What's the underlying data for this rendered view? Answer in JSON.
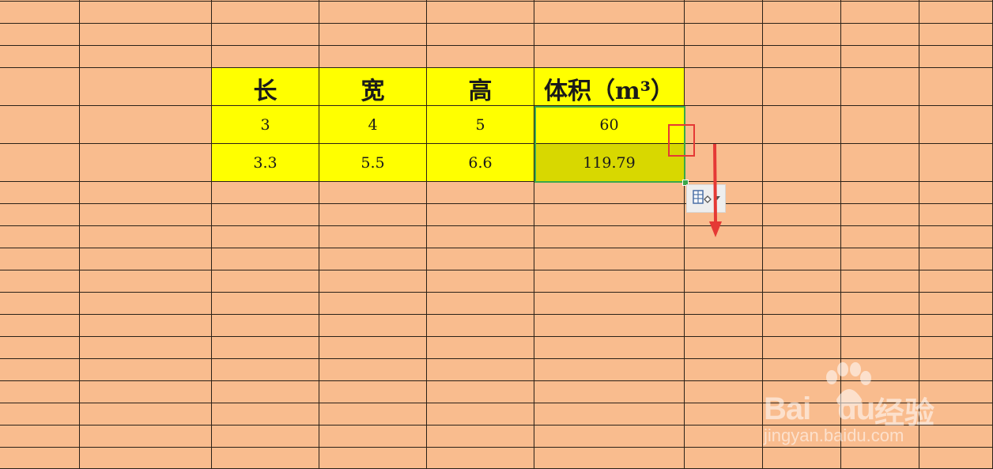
{
  "table": {
    "headers": [
      "长",
      "宽",
      "高",
      "体积（m³）"
    ],
    "rows": [
      [
        "3",
        "4",
        "5",
        "60"
      ],
      [
        "3.3",
        "5.5",
        "6.6",
        "119.79"
      ]
    ]
  },
  "selection": {
    "range": "volume column, rows 1-2",
    "color": "#3aa84a"
  },
  "annotations": {
    "highlight_color": "#e53935",
    "arrow_direction": "down"
  },
  "autofill_options": {
    "icon": "autofill-options-icon",
    "dropdown_icon": "chevron-down-icon"
  },
  "watermark": {
    "brand": "Bai",
    "brand_du": "du",
    "brand_cn": "经验",
    "url": "jingyan.baidu.com"
  },
  "colors": {
    "sheet_background": "#f9bc8e",
    "table_fill": "#ffff00",
    "selected_fill": "#d8d800",
    "grid_line": "#2b2118"
  }
}
